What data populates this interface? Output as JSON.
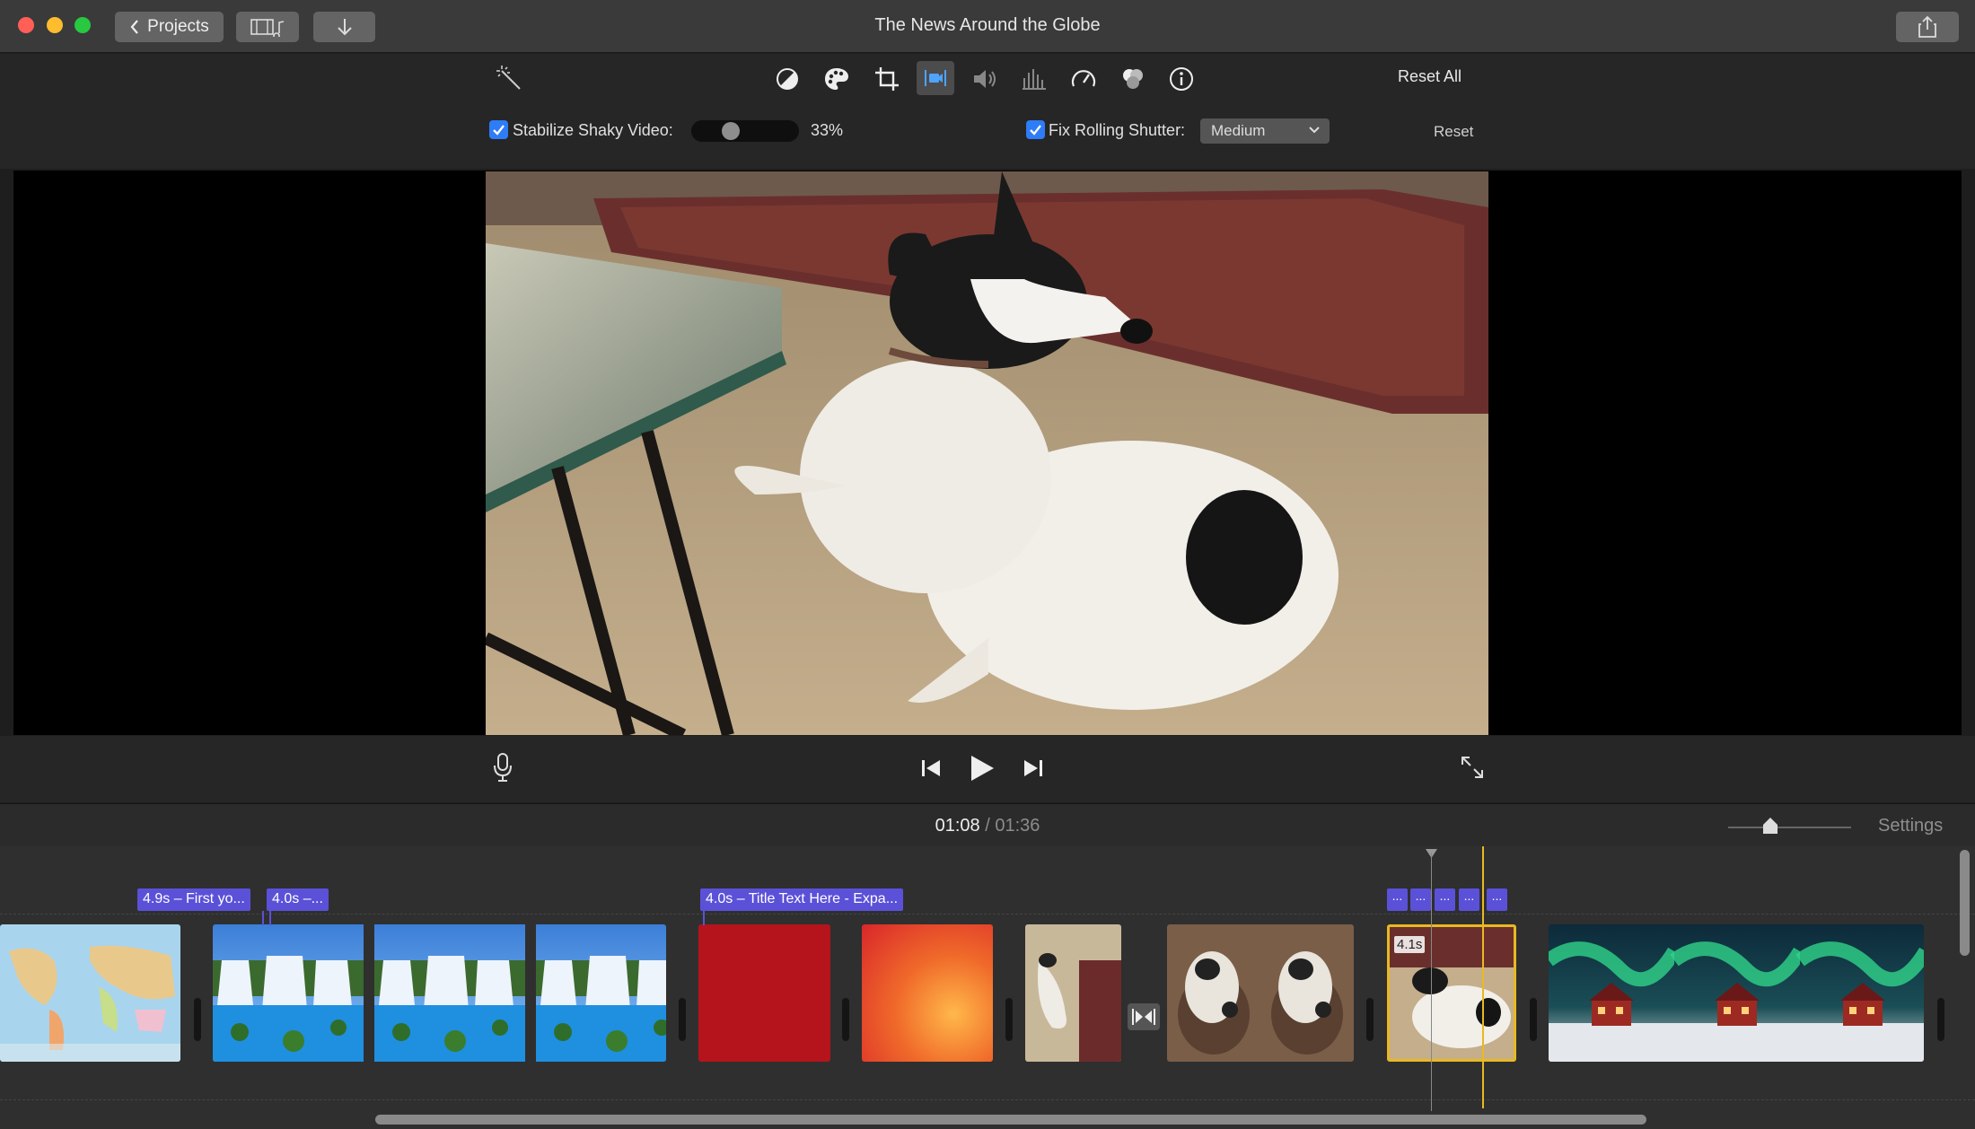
{
  "window": {
    "title": "The News Around the Globe"
  },
  "titlebar": {
    "projects_label": "Projects"
  },
  "toolbar": {
    "reset_all": "Reset All",
    "icons": [
      "magic-wand-icon",
      "color-balance-icon",
      "color-palette-icon",
      "crop-icon",
      "stabilization-icon",
      "volume-icon",
      "equalizer-icon",
      "speed-icon",
      "filter-icon",
      "info-icon"
    ]
  },
  "stabilize": {
    "label": "Stabilize Shaky Video:",
    "value": "33%",
    "level": 0.33
  },
  "rolling_shutter": {
    "label": "Fix Rolling Shutter:",
    "selected": "Medium"
  },
  "reset_label": "Reset",
  "timecode": {
    "current": "01:08",
    "separator": "/",
    "total": "01:36"
  },
  "settings_label": "Settings",
  "titles": {
    "t1": "4.9s – First yo...",
    "t2": "4.0s –...",
    "t3": "4.0s – Title Text Here - Expa...",
    "mini": [
      "...",
      "...",
      "...",
      "...",
      "..."
    ]
  },
  "clip_duration_badge": "4.1s",
  "colors": {
    "accent": "#2e7cf6",
    "title_tag": "#5b51d8",
    "selection": "#e8b923"
  }
}
